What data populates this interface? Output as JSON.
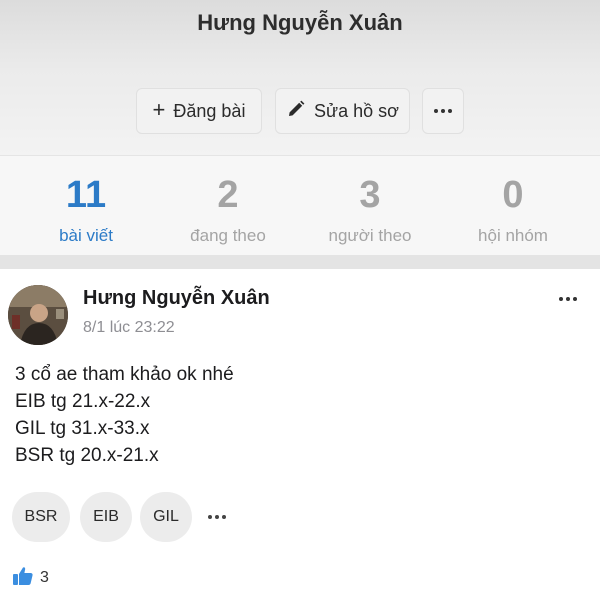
{
  "profile": {
    "name": "Hưng Nguyễn Xuân"
  },
  "actions": {
    "post_label": "Đăng bài",
    "edit_label": "Sửa hồ sơ",
    "post_icon": "plus-icon",
    "edit_icon": "pencil-icon",
    "more_icon": "more-icon"
  },
  "stats": [
    {
      "value": "11",
      "label": "bài viết",
      "active": true
    },
    {
      "value": "2",
      "label": "đang theo",
      "active": false
    },
    {
      "value": "3",
      "label": "người theo",
      "active": false
    },
    {
      "value": "0",
      "label": "hội nhóm",
      "active": false
    }
  ],
  "post": {
    "author": "Hưng Nguyễn Xuân",
    "time": "8/1 lúc 23:22",
    "lines": [
      "3 cổ ae tham khảo ok nhé",
      "EIB tg 21.x-22.x",
      "GIL tg 31.x-33.x",
      "BSR tg 20.x-21.x"
    ],
    "tags": [
      "BSR",
      "EIB",
      "GIL"
    ],
    "likes": "3"
  },
  "colors": {
    "accent": "#2c7bc7",
    "muted": "#a4a4a4",
    "like": "#3b8ee0"
  }
}
